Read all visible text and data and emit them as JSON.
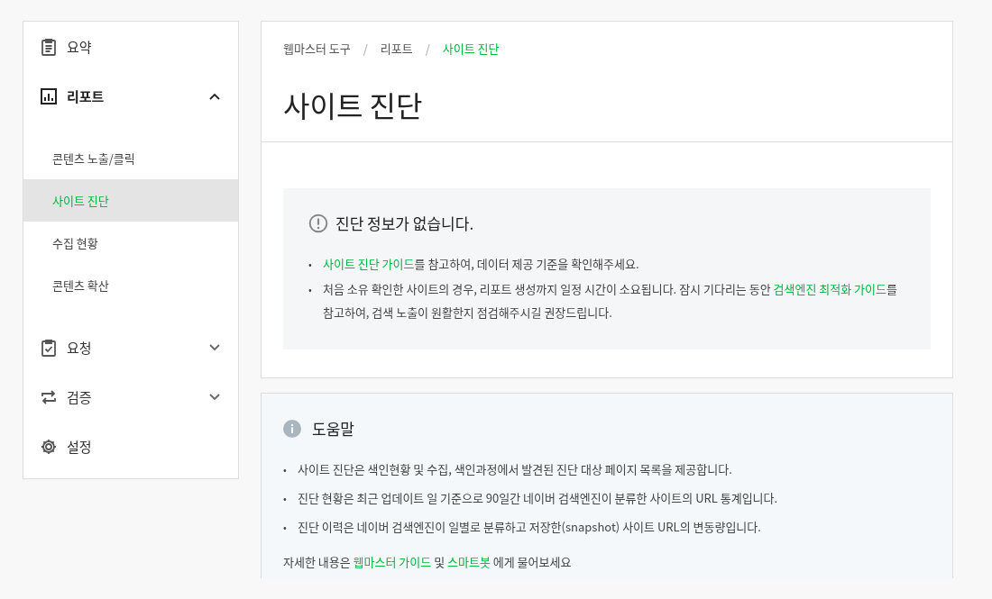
{
  "sidebar": {
    "items": [
      {
        "label": "요약",
        "selected": false
      },
      {
        "label": "리포트",
        "selected": true,
        "expanded": true,
        "children": [
          {
            "label": "콘텐츠 노출/클릭",
            "selected": false
          },
          {
            "label": "사이트 진단",
            "selected": true
          },
          {
            "label": "수집 현황",
            "selected": false
          },
          {
            "label": "콘텐츠 확산",
            "selected": false
          }
        ]
      },
      {
        "label": "요청",
        "selected": false,
        "expanded": false
      },
      {
        "label": "검증",
        "selected": false,
        "expanded": false
      },
      {
        "label": "설정",
        "selected": false
      }
    ]
  },
  "breadcrumb": [
    {
      "label": "웹마스터 도구",
      "selected": false
    },
    {
      "label": "리포트",
      "selected": false
    },
    {
      "label": "사이트 진단",
      "selected": true
    }
  ],
  "breadcrumb_separator": "/",
  "page_title": "사이트 진단",
  "bullet": "•",
  "notice": {
    "title": "진단 정보가 없습니다.",
    "items": [
      [
        {
          "text": "사이트 진단 가이드",
          "link": true
        },
        {
          "text": "를 참고하여, 데이터 제공 기준을 확인해주세요.",
          "link": false
        }
      ],
      [
        {
          "text": "처음 소유 확인한 사이트의 경우, 리포트 생성까지 일정 시간이 소요됩니다. 잠시 기다리는 동안 ",
          "link": false
        },
        {
          "text": "검색엔진 최적화 가이드",
          "link": true
        },
        {
          "text": "를 참고하여, 검색 노출이 원활한지 점검해주시길 권장드립니다.",
          "link": false
        }
      ]
    ]
  },
  "help": {
    "title": "도움말",
    "items": [
      "사이트 진단은 색인현황 및 수집, 색인과정에서 발견된 진단 대상 페이지 목록을 제공합니다.",
      "진단 현황은 최근 업데이트 일 기준으로 90일간 네이버 검색엔진이 분류한 사이트의 URL 통계입니다.",
      "진단 이력은 네이버 검색엔진이 일별로 분류하고 저장한(snapshot) 사이트 URL의 변동량입니다."
    ],
    "footer": [
      {
        "text": "자세한 내용은 ",
        "link": false
      },
      {
        "text": "웹마스터 가이드",
        "link": true
      },
      {
        "text": " 및 ",
        "link": false
      },
      {
        "text": "스마트봇",
        "link": true
      },
      {
        "text": " 에게 물어보세요",
        "link": false
      }
    ]
  }
}
